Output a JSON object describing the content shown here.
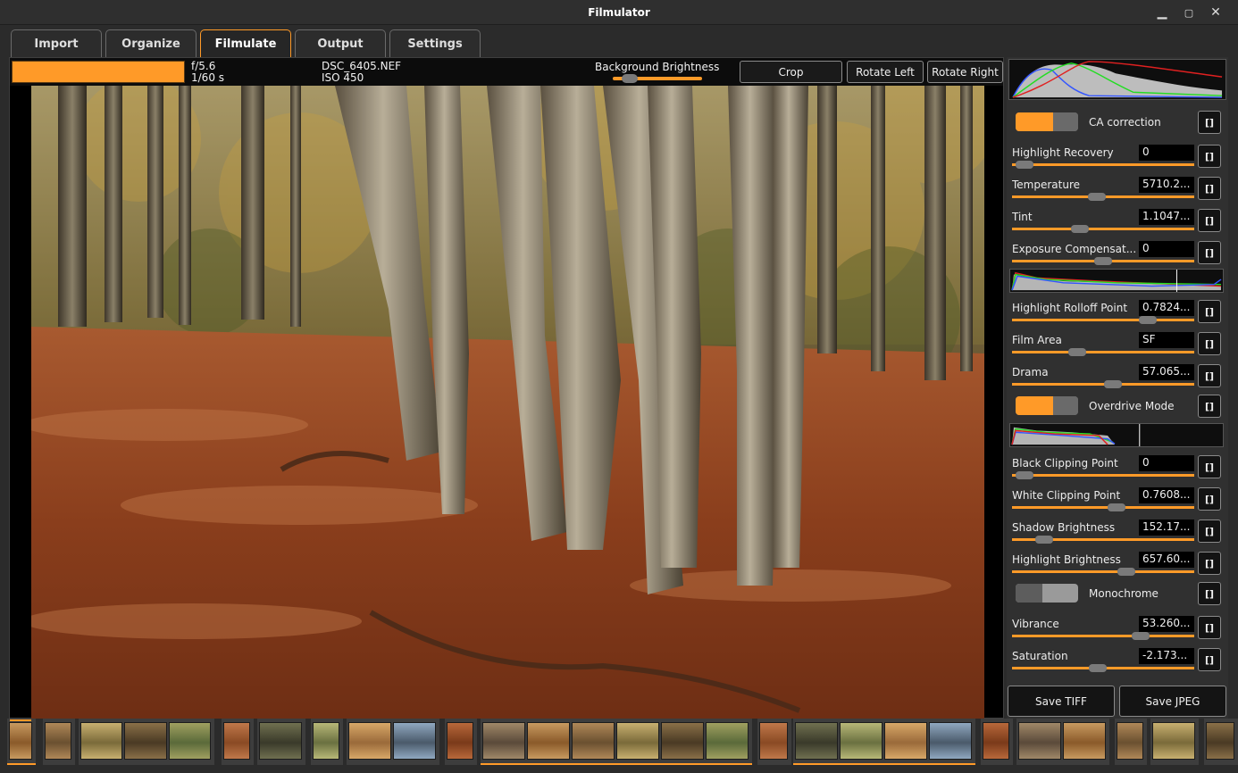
{
  "window": {
    "title": "Filmulator"
  },
  "tabs": [
    {
      "label": "Import",
      "active": false
    },
    {
      "label": "Organize",
      "active": false
    },
    {
      "label": "Filmulate",
      "active": true
    },
    {
      "label": "Output",
      "active": false
    },
    {
      "label": "Settings",
      "active": false
    }
  ],
  "infobar": {
    "progress_fraction": 1.0,
    "aperture": "f/5.6",
    "shutter": "1/60 s",
    "filename": "DSC_6405.NEF",
    "iso": "ISO 450",
    "background_brightness_label": "Background Brightness",
    "background_brightness_fraction": 0.12,
    "crop_label": "Crop",
    "rotate_left_label": "Rotate Left",
    "rotate_right_label": "Rotate Right"
  },
  "tools": {
    "reset_label": "[]",
    "ca_correction": {
      "label": "CA correction",
      "on": true
    },
    "highlight_recovery": {
      "label": "Highlight Recovery",
      "value": "0",
      "fraction": 0.02
    },
    "temperature": {
      "label": "Temperature",
      "value": "5710.2...",
      "fraction": 0.46
    },
    "tint": {
      "label": "Tint",
      "value": "1.1047...",
      "fraction": 0.36
    },
    "exposure_compensation": {
      "label": "Exposure Compensat...",
      "value": "0",
      "fraction": 0.5
    },
    "highlight_rolloff_point": {
      "label": "Highlight Rolloff Point",
      "value": "0.7824...",
      "fraction": 0.77
    },
    "film_area": {
      "label": "Film Area",
      "value": "SF",
      "fraction": 0.34
    },
    "drama": {
      "label": "Drama",
      "value": "57.065...",
      "fraction": 0.56
    },
    "overdrive_mode": {
      "label": "Overdrive Mode",
      "on": true
    },
    "black_clipping_point": {
      "label": "Black Clipping Point",
      "value": "0",
      "fraction": 0.02
    },
    "white_clipping_point": {
      "label": "White Clipping Point",
      "value": "0.7608...",
      "fraction": 0.58
    },
    "shadow_brightness": {
      "label": "Shadow Brightness",
      "value": "152.17...",
      "fraction": 0.14
    },
    "highlight_brightness": {
      "label": "Highlight Brightness",
      "value": "657.60...",
      "fraction": 0.64
    },
    "monochrome": {
      "label": "Monochrome",
      "on": false
    },
    "vibrance": {
      "label": "Vibrance",
      "value": "53.260...",
      "fraction": 0.73
    },
    "saturation": {
      "label": "Saturation",
      "value": "-2.173...",
      "fraction": 0.47
    }
  },
  "output": {
    "save_tiff_label": "Save TIFF",
    "save_jpeg_label": "Save JPEG"
  },
  "colors": {
    "accent": "#ff9a28",
    "panel": "#303030",
    "background": "#2b2b2b"
  }
}
